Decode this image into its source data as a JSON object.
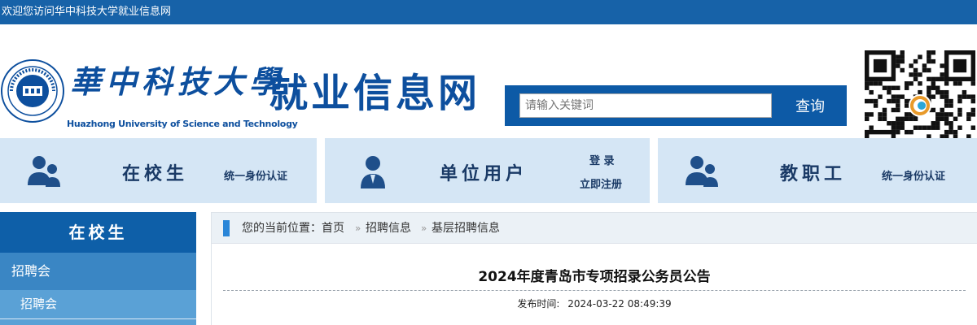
{
  "topbar": {
    "welcome": "欢迎您访问华中科技大学就业信息网"
  },
  "header": {
    "university_cn": "華中科技大學",
    "university_en": "Huazhong University of Science and Technology",
    "site_title": "就业信息网",
    "search": {
      "placeholder": "请输入关键词",
      "button_label": "查询"
    }
  },
  "nav": [
    {
      "label": "在校生",
      "sub": "统一身份认证"
    },
    {
      "label": "单位用户",
      "sub_login": "登 录",
      "sub_register": "立即注册"
    },
    {
      "label": "教职工",
      "sub": "统一身份认证"
    }
  ],
  "sidebar": {
    "title": "在校生",
    "item": "招聘会",
    "subitem": "招聘会"
  },
  "breadcrumb": {
    "prefix": "您的当前位置：",
    "items": [
      "首页",
      "招聘信息",
      "基层招聘信息"
    ],
    "separator": "»"
  },
  "article": {
    "title": "2024年度青岛市专项招录公务员公告",
    "published_label": "发布时间:",
    "published_value": "2024-03-22 08:49:39"
  },
  "colors": {
    "primary": "#0d5aa6",
    "topbar": "#1762a8",
    "nav_bg": "#d5e6f5",
    "sidebar_item": "#3a86c4",
    "sidebar_sub": "#5aa1d6"
  }
}
